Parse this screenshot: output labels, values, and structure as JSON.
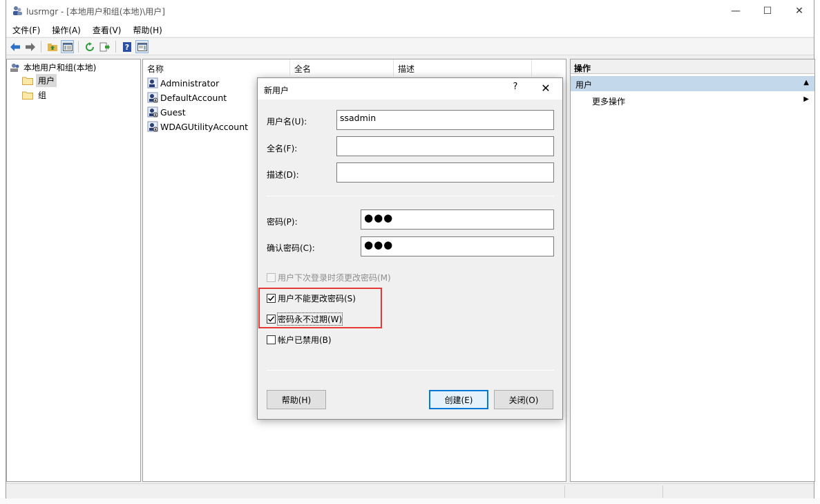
{
  "window": {
    "title": "lusrmgr - [本地用户和组(本地)\\用户]",
    "controls": {
      "minimize": "—",
      "maximize": "☐",
      "close": "✕"
    }
  },
  "menu": [
    {
      "label": "文件(F)"
    },
    {
      "label": "操作(A)"
    },
    {
      "label": "查看(V)"
    },
    {
      "label": "帮助(H)"
    }
  ],
  "toolbar": {
    "icons": [
      "back-arrow-icon",
      "forward-arrow-icon",
      "up-folder-icon",
      "show-hide-tree-icon",
      "refresh-icon",
      "export-list-icon",
      "help-icon",
      "show-hide-action-pane-icon"
    ]
  },
  "tree": {
    "root": "本地用户和组(本地)",
    "children": [
      {
        "label": "用户",
        "selected": true
      },
      {
        "label": "组",
        "selected": false
      }
    ]
  },
  "list": {
    "columns": [
      "名称",
      "全名",
      "描述"
    ],
    "rows": [
      {
        "name": "Administrator"
      },
      {
        "name": "DefaultAccount"
      },
      {
        "name": "Guest"
      },
      {
        "name": "WDAGUtilityAccount"
      }
    ]
  },
  "actions": {
    "header": "操作",
    "section": "用户",
    "items": [
      {
        "label": "更多操作"
      }
    ]
  },
  "dialog": {
    "title": "新用户",
    "help_glyph": "?",
    "close_glyph": "✕",
    "fields": {
      "username": {
        "label": "用户名(U):",
        "value": "ssadmin"
      },
      "fullname": {
        "label": "全名(F):",
        "value": ""
      },
      "description": {
        "label": "描述(D):",
        "value": ""
      },
      "password": {
        "label": "密码(P):",
        "value": "●●●"
      },
      "confirm": {
        "label": "确认密码(C):",
        "value": "●●●"
      }
    },
    "checkboxes": {
      "must_change": {
        "label": "用户下次登录时须更改密码(M)",
        "checked": false,
        "enabled": false
      },
      "cannot_change": {
        "label": "用户不能更改密码(S)",
        "checked": true,
        "enabled": true
      },
      "never_expires": {
        "label": "密码永不过期(W)",
        "checked": true,
        "enabled": true
      },
      "disabled": {
        "label": "帐户已禁用(B)",
        "checked": false,
        "enabled": true
      }
    },
    "buttons": {
      "help": "帮助(H)",
      "create": "创建(E)",
      "close": "关闭(O)"
    },
    "highlight_color": "#e53935"
  },
  "colors": {
    "selection": "#c4d8ec",
    "accent": "#0078d7"
  }
}
